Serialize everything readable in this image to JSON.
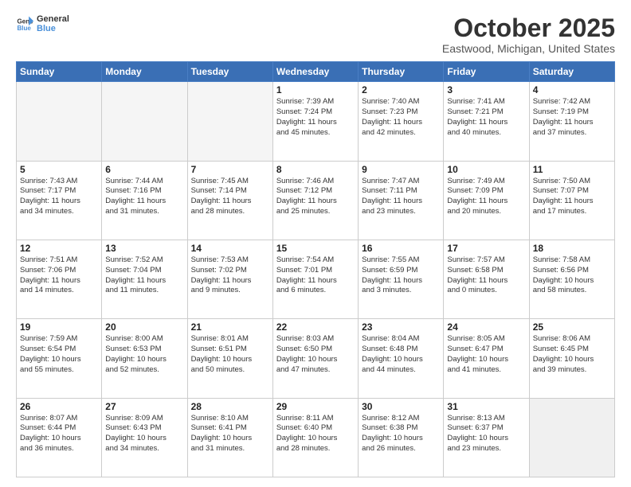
{
  "header": {
    "logo_line1": "General",
    "logo_line2": "Blue",
    "month": "October 2025",
    "location": "Eastwood, Michigan, United States"
  },
  "weekdays": [
    "Sunday",
    "Monday",
    "Tuesday",
    "Wednesday",
    "Thursday",
    "Friday",
    "Saturday"
  ],
  "weeks": [
    [
      {
        "day": "",
        "empty": true
      },
      {
        "day": "",
        "empty": true
      },
      {
        "day": "",
        "empty": true
      },
      {
        "day": "1",
        "lines": [
          "Sunrise: 7:39 AM",
          "Sunset: 7:24 PM",
          "Daylight: 11 hours",
          "and 45 minutes."
        ]
      },
      {
        "day": "2",
        "lines": [
          "Sunrise: 7:40 AM",
          "Sunset: 7:23 PM",
          "Daylight: 11 hours",
          "and 42 minutes."
        ]
      },
      {
        "day": "3",
        "lines": [
          "Sunrise: 7:41 AM",
          "Sunset: 7:21 PM",
          "Daylight: 11 hours",
          "and 40 minutes."
        ]
      },
      {
        "day": "4",
        "lines": [
          "Sunrise: 7:42 AM",
          "Sunset: 7:19 PM",
          "Daylight: 11 hours",
          "and 37 minutes."
        ]
      }
    ],
    [
      {
        "day": "5",
        "lines": [
          "Sunrise: 7:43 AM",
          "Sunset: 7:17 PM",
          "Daylight: 11 hours",
          "and 34 minutes."
        ]
      },
      {
        "day": "6",
        "lines": [
          "Sunrise: 7:44 AM",
          "Sunset: 7:16 PM",
          "Daylight: 11 hours",
          "and 31 minutes."
        ]
      },
      {
        "day": "7",
        "lines": [
          "Sunrise: 7:45 AM",
          "Sunset: 7:14 PM",
          "Daylight: 11 hours",
          "and 28 minutes."
        ]
      },
      {
        "day": "8",
        "lines": [
          "Sunrise: 7:46 AM",
          "Sunset: 7:12 PM",
          "Daylight: 11 hours",
          "and 25 minutes."
        ]
      },
      {
        "day": "9",
        "lines": [
          "Sunrise: 7:47 AM",
          "Sunset: 7:11 PM",
          "Daylight: 11 hours",
          "and 23 minutes."
        ]
      },
      {
        "day": "10",
        "lines": [
          "Sunrise: 7:49 AM",
          "Sunset: 7:09 PM",
          "Daylight: 11 hours",
          "and 20 minutes."
        ]
      },
      {
        "day": "11",
        "lines": [
          "Sunrise: 7:50 AM",
          "Sunset: 7:07 PM",
          "Daylight: 11 hours",
          "and 17 minutes."
        ]
      }
    ],
    [
      {
        "day": "12",
        "lines": [
          "Sunrise: 7:51 AM",
          "Sunset: 7:06 PM",
          "Daylight: 11 hours",
          "and 14 minutes."
        ]
      },
      {
        "day": "13",
        "lines": [
          "Sunrise: 7:52 AM",
          "Sunset: 7:04 PM",
          "Daylight: 11 hours",
          "and 11 minutes."
        ]
      },
      {
        "day": "14",
        "lines": [
          "Sunrise: 7:53 AM",
          "Sunset: 7:02 PM",
          "Daylight: 11 hours",
          "and 9 minutes."
        ]
      },
      {
        "day": "15",
        "lines": [
          "Sunrise: 7:54 AM",
          "Sunset: 7:01 PM",
          "Daylight: 11 hours",
          "and 6 minutes."
        ]
      },
      {
        "day": "16",
        "lines": [
          "Sunrise: 7:55 AM",
          "Sunset: 6:59 PM",
          "Daylight: 11 hours",
          "and 3 minutes."
        ]
      },
      {
        "day": "17",
        "lines": [
          "Sunrise: 7:57 AM",
          "Sunset: 6:58 PM",
          "Daylight: 11 hours",
          "and 0 minutes."
        ]
      },
      {
        "day": "18",
        "lines": [
          "Sunrise: 7:58 AM",
          "Sunset: 6:56 PM",
          "Daylight: 10 hours",
          "and 58 minutes."
        ]
      }
    ],
    [
      {
        "day": "19",
        "lines": [
          "Sunrise: 7:59 AM",
          "Sunset: 6:54 PM",
          "Daylight: 10 hours",
          "and 55 minutes."
        ]
      },
      {
        "day": "20",
        "lines": [
          "Sunrise: 8:00 AM",
          "Sunset: 6:53 PM",
          "Daylight: 10 hours",
          "and 52 minutes."
        ]
      },
      {
        "day": "21",
        "lines": [
          "Sunrise: 8:01 AM",
          "Sunset: 6:51 PM",
          "Daylight: 10 hours",
          "and 50 minutes."
        ]
      },
      {
        "day": "22",
        "lines": [
          "Sunrise: 8:03 AM",
          "Sunset: 6:50 PM",
          "Daylight: 10 hours",
          "and 47 minutes."
        ]
      },
      {
        "day": "23",
        "lines": [
          "Sunrise: 8:04 AM",
          "Sunset: 6:48 PM",
          "Daylight: 10 hours",
          "and 44 minutes."
        ]
      },
      {
        "day": "24",
        "lines": [
          "Sunrise: 8:05 AM",
          "Sunset: 6:47 PM",
          "Daylight: 10 hours",
          "and 41 minutes."
        ]
      },
      {
        "day": "25",
        "lines": [
          "Sunrise: 8:06 AM",
          "Sunset: 6:45 PM",
          "Daylight: 10 hours",
          "and 39 minutes."
        ]
      }
    ],
    [
      {
        "day": "26",
        "lines": [
          "Sunrise: 8:07 AM",
          "Sunset: 6:44 PM",
          "Daylight: 10 hours",
          "and 36 minutes."
        ]
      },
      {
        "day": "27",
        "lines": [
          "Sunrise: 8:09 AM",
          "Sunset: 6:43 PM",
          "Daylight: 10 hours",
          "and 34 minutes."
        ]
      },
      {
        "day": "28",
        "lines": [
          "Sunrise: 8:10 AM",
          "Sunset: 6:41 PM",
          "Daylight: 10 hours",
          "and 31 minutes."
        ]
      },
      {
        "day": "29",
        "lines": [
          "Sunrise: 8:11 AM",
          "Sunset: 6:40 PM",
          "Daylight: 10 hours",
          "and 28 minutes."
        ]
      },
      {
        "day": "30",
        "lines": [
          "Sunrise: 8:12 AM",
          "Sunset: 6:38 PM",
          "Daylight: 10 hours",
          "and 26 minutes."
        ]
      },
      {
        "day": "31",
        "lines": [
          "Sunrise: 8:13 AM",
          "Sunset: 6:37 PM",
          "Daylight: 10 hours",
          "and 23 minutes."
        ]
      },
      {
        "day": "",
        "empty": true,
        "shaded": true
      }
    ]
  ]
}
